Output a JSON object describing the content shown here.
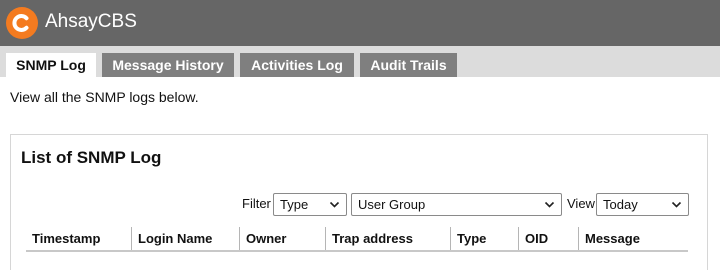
{
  "header": {
    "brand": "AhsayCBS",
    "accent": "#f47b20",
    "bg": "#666666",
    "logo_icon": "ahsay-logo-icon"
  },
  "tabs": [
    {
      "label": "SNMP Log",
      "active": true
    },
    {
      "label": "Message History",
      "active": false
    },
    {
      "label": "Activities Log",
      "active": false
    },
    {
      "label": "Audit Trails",
      "active": false
    }
  ],
  "intro": "View all the SNMP logs below.",
  "panel": {
    "title": "List of SNMP Log",
    "filter_label": "Filter",
    "filter_type": "Type",
    "filter_group": "User Group",
    "view_label": "View",
    "view_value": "Today",
    "columns": [
      "Timestamp",
      "Login Name",
      "Owner",
      "Trap address",
      "Type",
      "OID",
      "Message"
    ]
  }
}
